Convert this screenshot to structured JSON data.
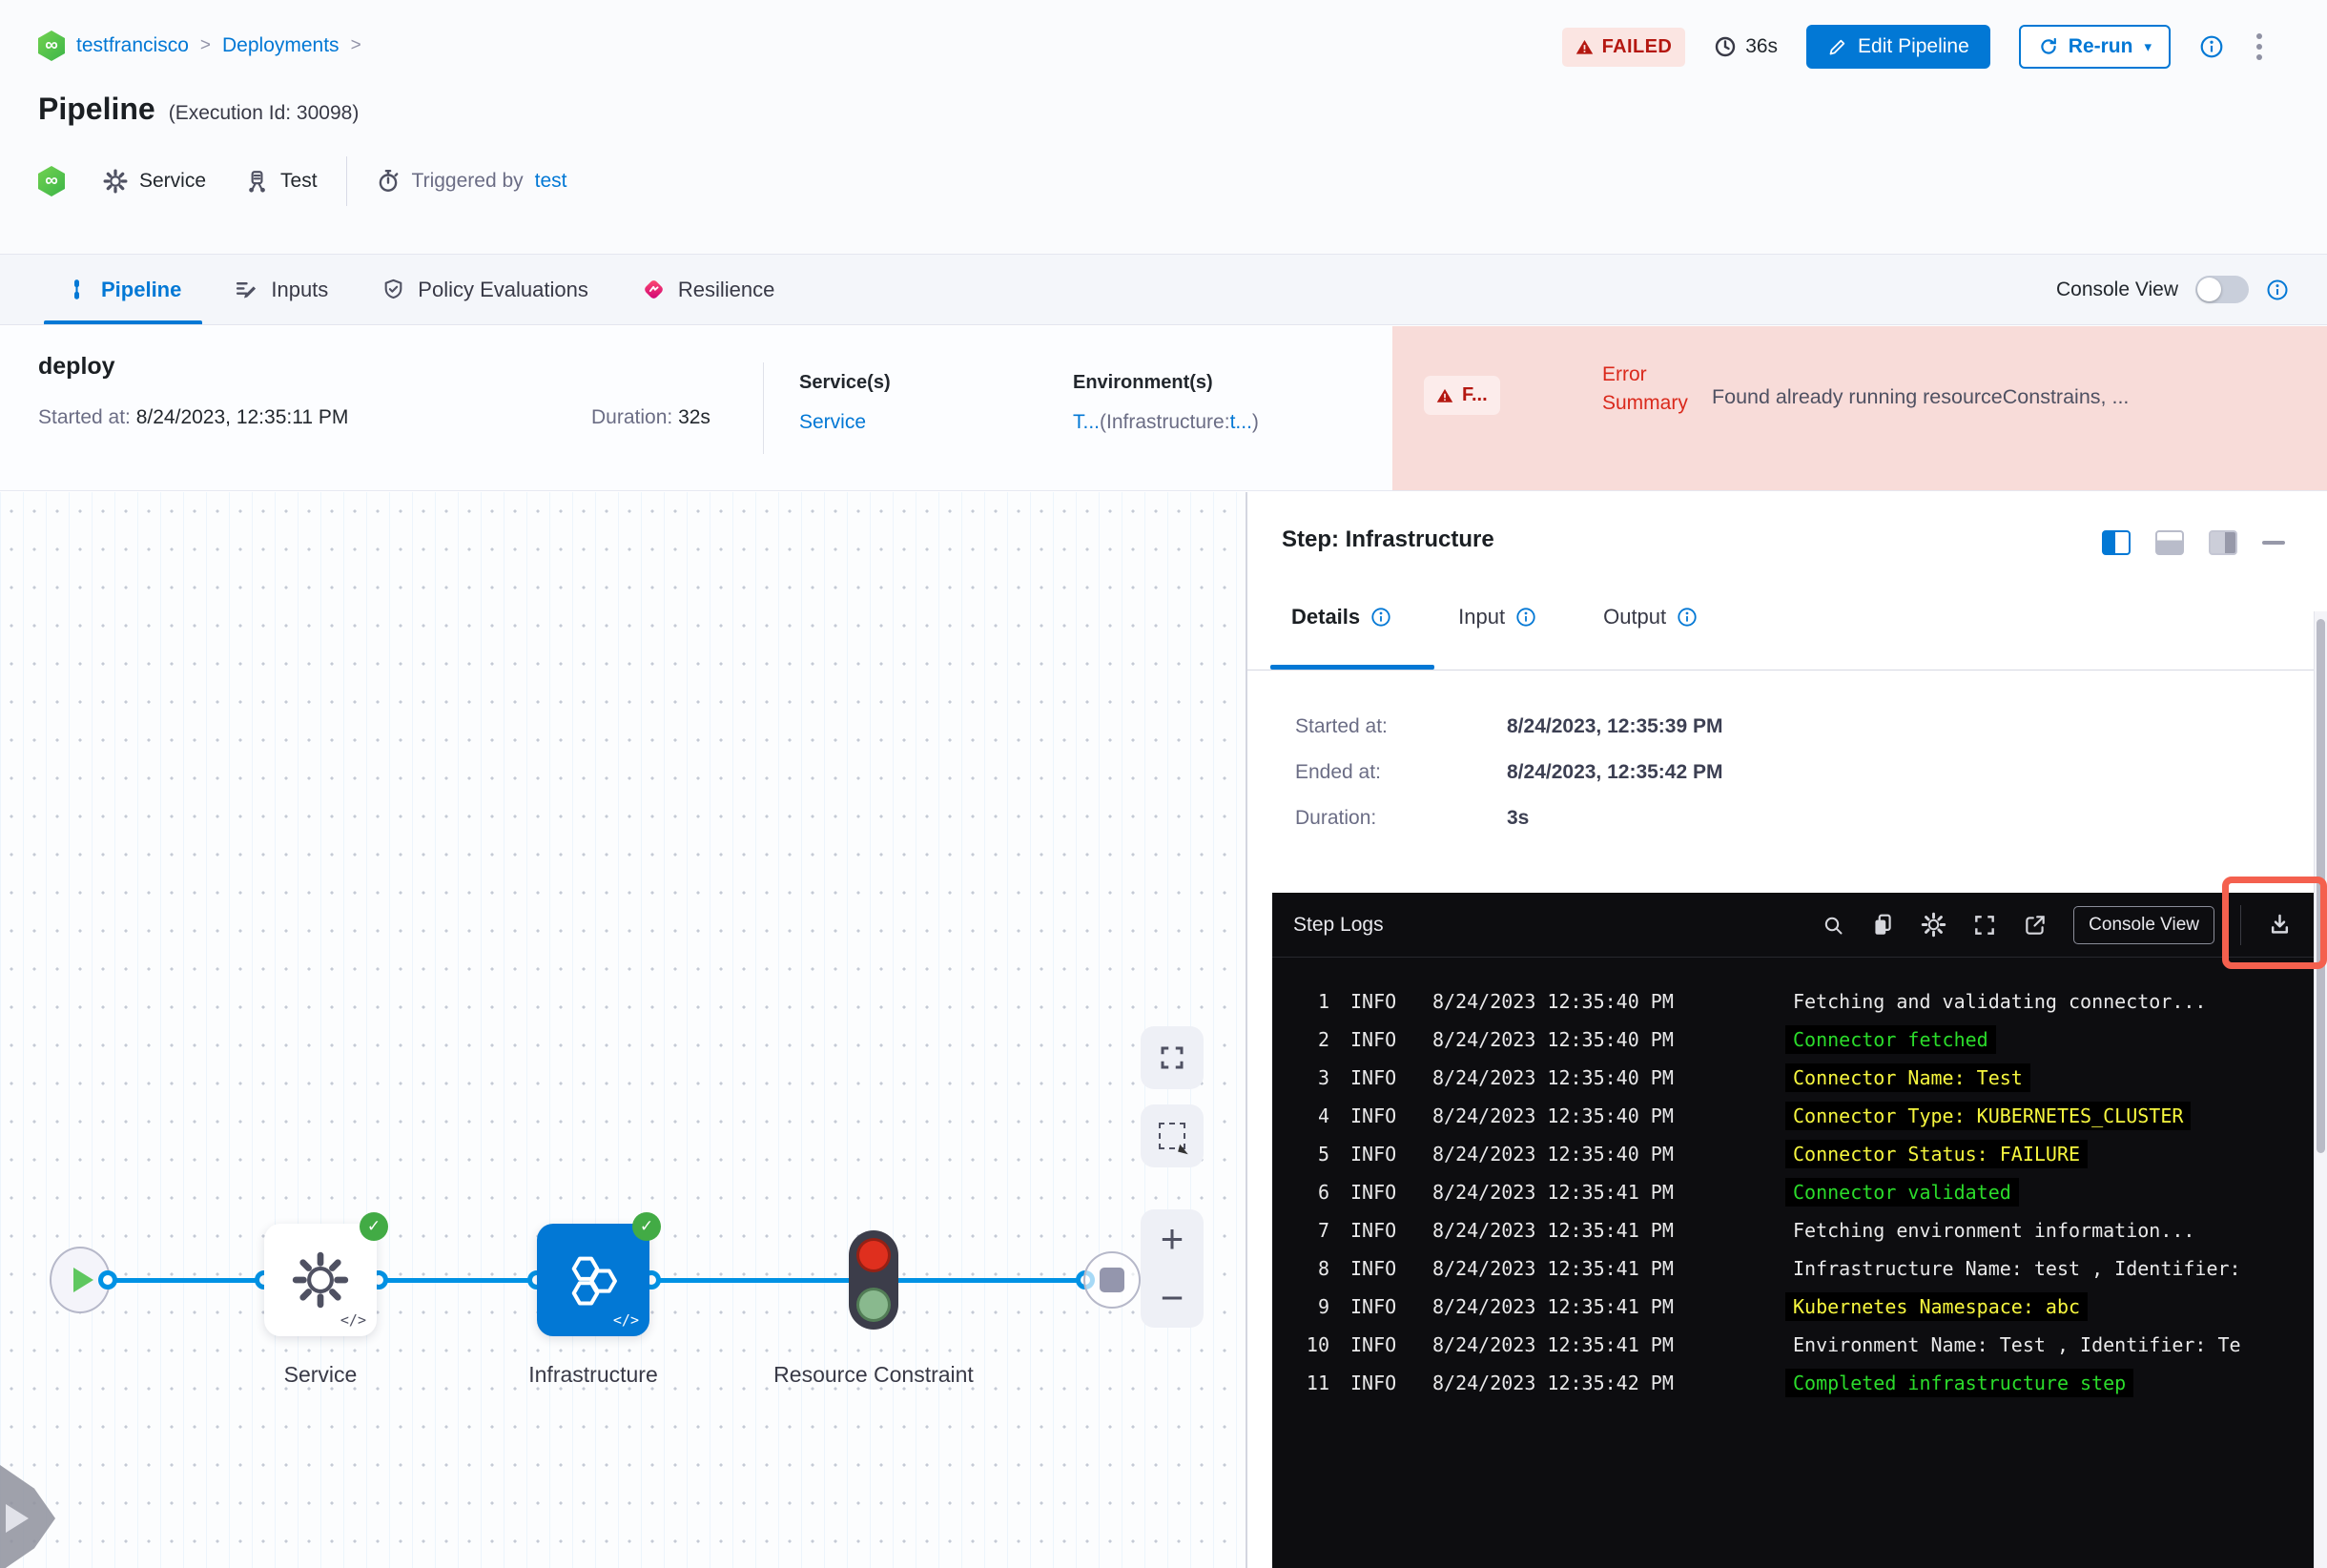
{
  "colors": {
    "accent_blue": "#0278d5",
    "edge_blue": "#0092e4",
    "failed_red": "#b41710",
    "error_red": "#da291c",
    "error_strip_pink": "#f8dcd9",
    "annotation_red": "#f4604e",
    "log_green": "#2bdc2b",
    "log_yellow": "#f6f63e",
    "log_white": "#e9e9ea",
    "node_blue": "#0278d5",
    "success_green": "#42ab45"
  },
  "glyphs": {
    "infinity": "∞",
    "separator": ">",
    "caret": "▾",
    "check": "✓",
    "code_marker": "</>",
    "plus": "+",
    "minus": "−"
  },
  "breadcrumb": {
    "project": "testfrancisco",
    "section": "Deployments"
  },
  "header": {
    "title": "Pipeline",
    "execution_id": "(Execution Id: 30098)",
    "status_badge": "FAILED",
    "elapsed": "36s",
    "edit_button": "Edit Pipeline",
    "rerun_button": "Re-run",
    "service_label": "Service",
    "test_label": "Test",
    "triggered_by_label": "Triggered by",
    "trigger_user": "test"
  },
  "tabbar": {
    "tabs": [
      {
        "label": "Pipeline"
      },
      {
        "label": "Inputs"
      },
      {
        "label": "Policy Evaluations"
      },
      {
        "label": "Resilience"
      }
    ],
    "console_view_label": "Console View"
  },
  "stage": {
    "name": "deploy",
    "started_label": "Started at:",
    "started_value": "8/24/2023, 12:35:11 PM",
    "duration_label": "Duration:",
    "duration_value": "32s",
    "services_label": "Service(s)",
    "service_link": "Service",
    "environments_label": "Environment(s)",
    "env_link1": "T...",
    "env_paren_open": "(Infrastructure:",
    "env_link2": "t...",
    "env_paren_close": ")",
    "failed_short": "F...",
    "error_summary_label": "Error Summary",
    "error_message": "Found already running resourceConstrains, ..."
  },
  "graph": {
    "service_label": "Service",
    "infrastructure_label": "Infrastructure",
    "resource_constraint_label": "Resource Constraint"
  },
  "panel": {
    "title": "Step: Infrastructure",
    "tabs": [
      {
        "label": "Details"
      },
      {
        "label": "Input"
      },
      {
        "label": "Output"
      }
    ],
    "details": {
      "started_label": "Started at:",
      "started_value": "8/24/2023, 12:35:39 PM",
      "ended_label": "Ended at:",
      "ended_value": "8/24/2023, 12:35:42 PM",
      "duration_label": "Duration:",
      "duration_value": "3s"
    }
  },
  "logs": {
    "title": "Step Logs",
    "console_view_button": "Console View",
    "rows": [
      {
        "num": "1",
        "level": "INFO",
        "time": "8/24/2023 12:35:40 PM",
        "message": "Fetching and validating connector...",
        "color": "#e9e9ea",
        "highlight": false
      },
      {
        "num": "2",
        "level": "INFO",
        "time": "8/24/2023 12:35:40 PM",
        "message": "Connector fetched",
        "color": "#2bdc2b",
        "highlight": true
      },
      {
        "num": "3",
        "level": "INFO",
        "time": "8/24/2023 12:35:40 PM",
        "message": "Connector Name: Test",
        "color": "#f6f63e",
        "highlight": true
      },
      {
        "num": "4",
        "level": "INFO",
        "time": "8/24/2023 12:35:40 PM",
        "message": "Connector Type: KUBERNETES_CLUSTER",
        "color": "#f6f63e",
        "highlight": true
      },
      {
        "num": "5",
        "level": "INFO",
        "time": "8/24/2023 12:35:40 PM",
        "message": "Connector Status: FAILURE",
        "color": "#f6f63e",
        "highlight": true
      },
      {
        "num": "6",
        "level": "INFO",
        "time": "8/24/2023 12:35:41 PM",
        "message": "Connector validated",
        "color": "#2bdc2b",
        "highlight": true
      },
      {
        "num": "7",
        "level": "INFO",
        "time": "8/24/2023 12:35:41 PM",
        "message": "Fetching environment information...",
        "color": "#e9e9ea",
        "highlight": false
      },
      {
        "num": "8",
        "level": "INFO",
        "time": "8/24/2023 12:35:41 PM",
        "message": "Infrastructure Name: test , Identifier:",
        "color": "#e9e9ea",
        "highlight": false
      },
      {
        "num": "9",
        "level": "INFO",
        "time": "8/24/2023 12:35:41 PM",
        "message": "Kubernetes Namespace: abc",
        "color": "#f6f63e",
        "highlight": true
      },
      {
        "num": "10",
        "level": "INFO",
        "time": "8/24/2023 12:35:41 PM",
        "message": "Environment Name: Test , Identifier: Te",
        "color": "#e9e9ea",
        "highlight": false
      },
      {
        "num": "11",
        "level": "INFO",
        "time": "8/24/2023 12:35:42 PM",
        "message": "Completed infrastructure step",
        "color": "#2bdc2b",
        "highlight": true
      }
    ]
  }
}
